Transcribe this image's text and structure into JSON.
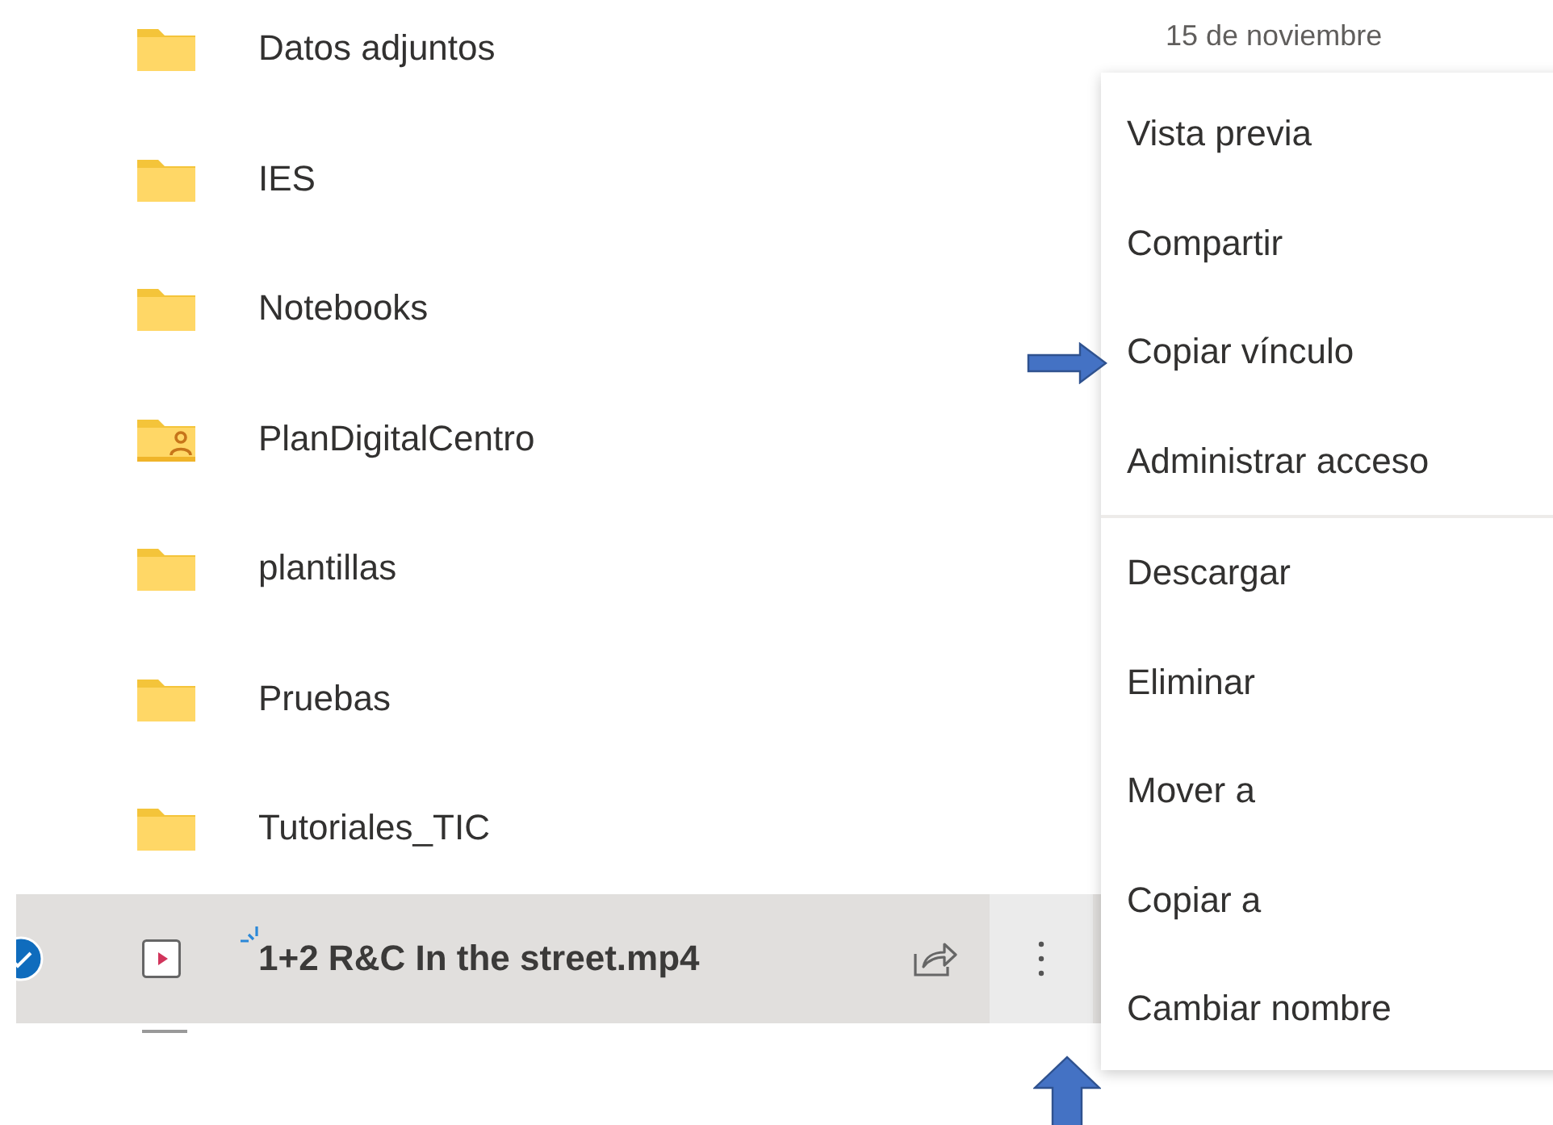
{
  "files": [
    {
      "name": "Datos adjuntos",
      "kind": "folder",
      "date": "15 de noviembre",
      "selected": false,
      "new": false
    },
    {
      "name": "IES",
      "kind": "folder",
      "selected": false,
      "new": false
    },
    {
      "name": "Notebooks",
      "kind": "folder",
      "selected": false,
      "new": false
    },
    {
      "name": "PlanDigitalCentro",
      "kind": "shared-folder",
      "selected": false,
      "new": false
    },
    {
      "name": "plantillas",
      "kind": "folder",
      "selected": false,
      "new": false
    },
    {
      "name": "Pruebas",
      "kind": "folder",
      "selected": false,
      "new": false
    },
    {
      "name": "Tutoriales_TIC",
      "kind": "folder",
      "selected": false,
      "new": false
    },
    {
      "name": "1+2 R&C In the street.mp4",
      "kind": "video",
      "selected": true,
      "new": true
    }
  ],
  "context_menu": {
    "sections": [
      [
        "Vista previa",
        "Compartir",
        "Copiar vínculo",
        "Administrar acceso"
      ],
      [
        "Descargar",
        "Eliminar",
        "Mover a",
        "Copiar a",
        "Cambiar nombre"
      ]
    ]
  },
  "annotations": [
    {
      "kind": "right"
    },
    {
      "kind": "up"
    }
  ]
}
